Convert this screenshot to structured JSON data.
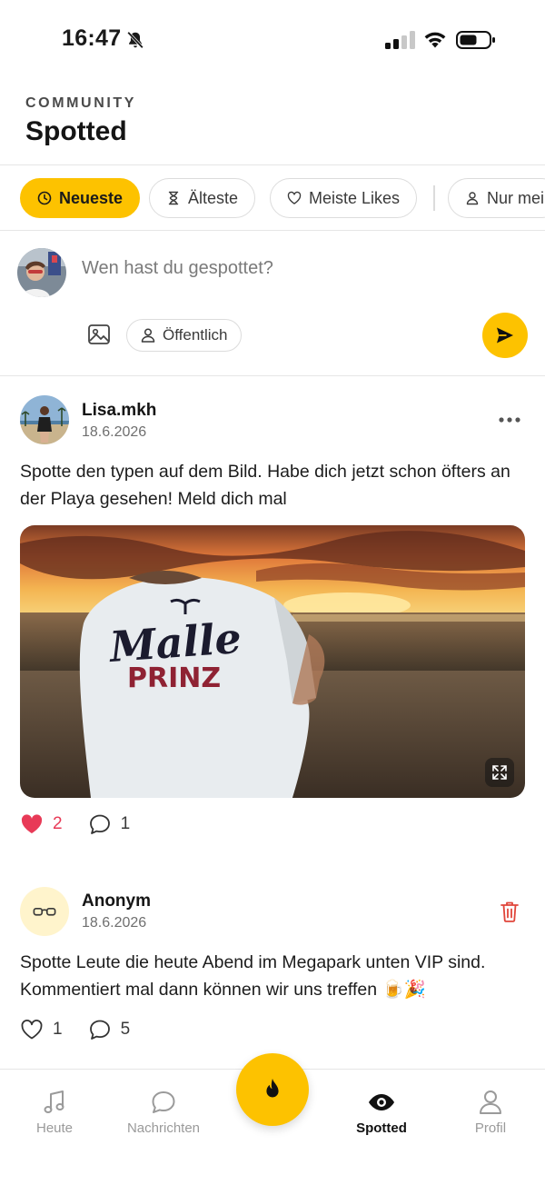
{
  "status_bar": {
    "time": "16:47"
  },
  "header": {
    "kicker": "COMMUNITY",
    "title": "Spotted"
  },
  "filters": [
    {
      "label": "Neueste",
      "icon": "clock-icon",
      "active": true
    },
    {
      "label": "Älteste",
      "icon": "hourglass-icon",
      "active": false
    },
    {
      "label": "Meiste Likes",
      "icon": "heart-outline-icon",
      "active": false
    },
    {
      "label": "Nur mei",
      "icon": "person-icon",
      "active": false
    }
  ],
  "composer": {
    "placeholder": "Wen hast du gespottet?",
    "visibility_label": "Öffentlich"
  },
  "posts": [
    {
      "author": "Lisa.mkh",
      "date": "18.6.2026",
      "text": "Spotte den typen auf dem Bild. Habe dich jetzt schon öfters an der Playa gesehen! Meld dich mal",
      "shirt_text_1": "Malle",
      "shirt_text_2": "PRINZ",
      "likes": "2",
      "comments": "1",
      "liked": true
    },
    {
      "author": "Anonym",
      "date": "18.6.2026",
      "text": "Spotte Leute die heute Abend im Megapark unten VIP sind. Kommentiert mal dann können wir uns treffen 🍺🎉",
      "likes": "1",
      "comments": "5",
      "liked": false
    }
  ],
  "nav": [
    {
      "label": "Heute",
      "icon": "music-note-icon"
    },
    {
      "label": "Nachrichten",
      "icon": "chat-bubble-icon"
    },
    {
      "label": "Spotted",
      "icon": "eye-icon",
      "active": true
    },
    {
      "label": "Profil",
      "icon": "person-icon"
    }
  ],
  "colors": {
    "accent": "#fdc200",
    "like": "#e83a57",
    "delete": "#e0453a"
  }
}
